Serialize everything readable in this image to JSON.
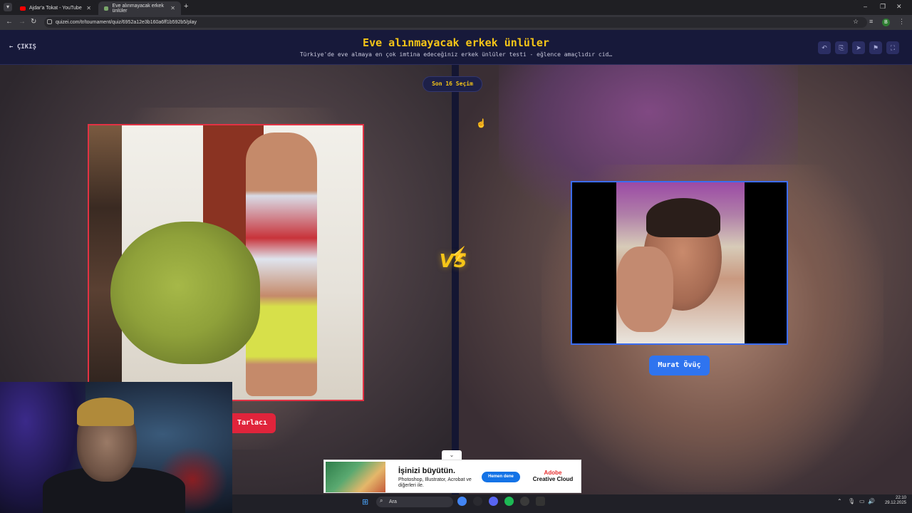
{
  "browser": {
    "tabs": [
      {
        "title": "Ajdar'a Tokat - YouTube",
        "color": "#ff0000"
      },
      {
        "title": "Eve alınmayacak erkek ünlüler",
        "color": "#7aa66a"
      }
    ],
    "url": "quizei.com/tr/tournament/quiz/6952a12e3b160a6ff1b592b5/play",
    "profile_initial": "B"
  },
  "header": {
    "exit_label": "ÇIKIŞ",
    "title": "Eve alınmayacak erkek ünlüler",
    "subtitle": "Türkiye'de eve almaya en çok imtina edeceğiniz erkek ünlüler testi - eğlence amaçlıdır cid…",
    "icons": [
      "undo-icon",
      "share-icon",
      "send-icon",
      "flag-icon",
      "fullscreen-icon"
    ]
  },
  "game": {
    "round_label": "Son 16 Seçim",
    "vs_label": "VS",
    "left_choice": {
      "name": "Tarlacı",
      "accent": "#e0243b"
    },
    "right_choice": {
      "name": "Murat Övüç",
      "accent": "#2f74ef"
    }
  },
  "ad": {
    "headline": "İşinizi büyütün.",
    "body": "Photoshop, Illustrator, Acrobat ve diğerleri ile.",
    "cta": "Hemen dene",
    "brand_line1": "Adobe",
    "brand_line2": "Creative Cloud"
  },
  "taskbar": {
    "search_placeholder": "Ara",
    "time": "22:10",
    "date": "29.12.2025"
  }
}
